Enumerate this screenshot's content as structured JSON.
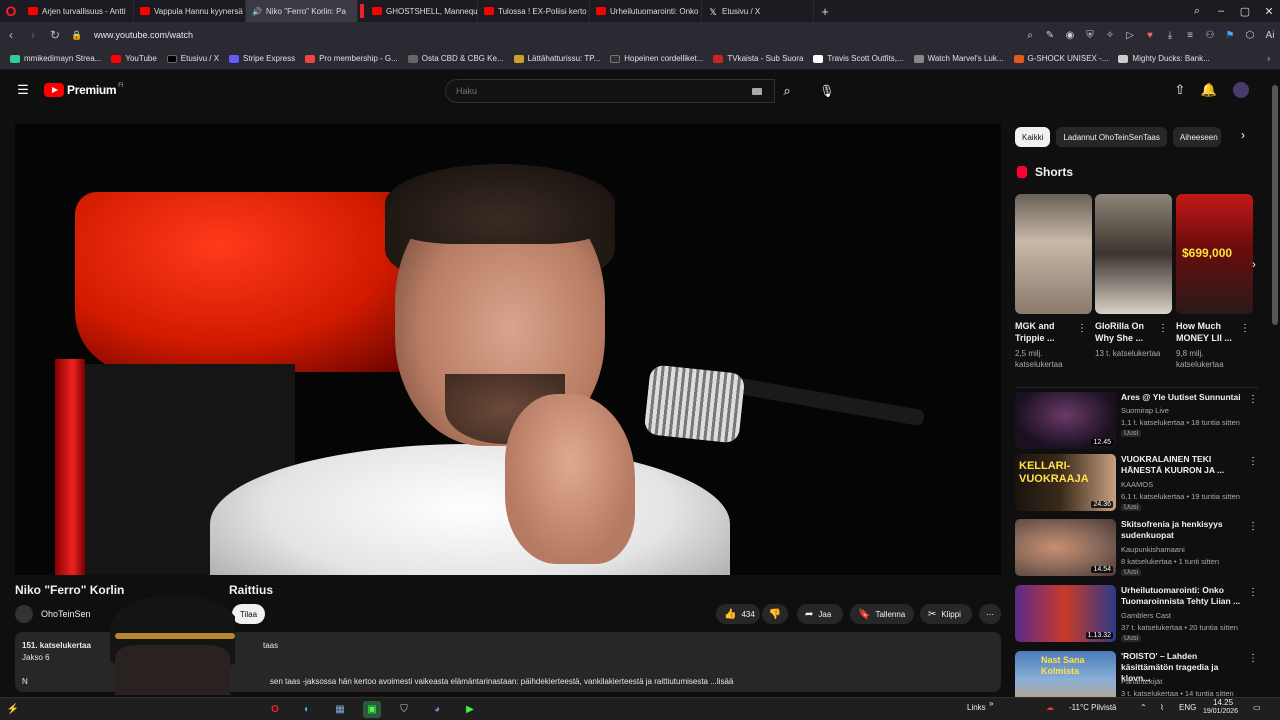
{
  "browser": {
    "tabs": [
      {
        "label": "Arjen turvallisuus - Antti",
        "icon": "youtube-icon"
      },
      {
        "label": "Vappula Hannu kyynersä",
        "icon": "youtube-icon"
      },
      {
        "label": "Niko \"Ferro\" Korlin: Pa",
        "icon": "audio-icon",
        "active": true
      },
      {
        "label": "GHOSTSHELL, Mannequi",
        "icon": "youtube-icon"
      },
      {
        "label": "Tulossa ! EX-Poliisi kerto",
        "icon": "youtube-icon"
      },
      {
        "label": "Urheilutuomarointi: Onko",
        "icon": "youtube-icon"
      },
      {
        "label": "Etusivu / X",
        "icon": "x-icon"
      }
    ],
    "url": "www.youtube.com/watch",
    "bookmarks": [
      {
        "label": "mmikedimayn Strea...",
        "color": "#3c9"
      },
      {
        "label": "YouTube",
        "color": "#ff0000"
      },
      {
        "label": "Etusivu / X",
        "color": "#000000"
      },
      {
        "label": "Stripe Express",
        "color": "#635bff"
      },
      {
        "label": "Pro membership - G...",
        "color": "#e44"
      },
      {
        "label": "Osta CBD & CBG Ke...",
        "color": "#666"
      },
      {
        "label": "Lättähatturissu: TP...",
        "color": "#c9a227"
      },
      {
        "label": "Hopeinen cordelliket...",
        "color": "#333"
      },
      {
        "label": "TVkaista - Sub Suora",
        "color": "#c22"
      },
      {
        "label": "Travis Scott Outfits,...",
        "color": "#fff"
      },
      {
        "label": "Watch Marvel's Luk...",
        "color": "#888"
      },
      {
        "label": "G-SHOCK UNISEX -...",
        "color": "#e55a1a"
      },
      {
        "label": "Mighty Ducks: Bank...",
        "color": "#ccc"
      }
    ]
  },
  "youtube": {
    "logo_text": "Premium",
    "logo_sup": "FI",
    "search_placeholder": "Haku",
    "video": {
      "title_left": "Niko \"Ferro\" Korlin",
      "title_right": "Raittius",
      "channel": "OhoTeinSen",
      "subscribe_label": "Tilaa",
      "likes": "434",
      "share_label": "Jaa",
      "save_label": "Tallenna",
      "clip_label": "Klippi",
      "desc_views": "151. katselukertaa",
      "desc_line2": "Jakso 6",
      "desc_taas": "taas",
      "desc_text": "sen taas -jaksossa hän kertoo avoimesti vaikeasta elämäntarinastaan: päihdekierteestä, vankilakierteestä ja raittiutumisesta  ...lisää",
      "desc_n": "N"
    },
    "chips": [
      {
        "label": "Kaikki",
        "active": true
      },
      {
        "label": "Ladannut OhoTeinSenTaas",
        "active": false
      },
      {
        "label": "Aiheeseen",
        "active": false
      }
    ],
    "shorts_header": "Shorts",
    "shorts": [
      {
        "title": "MGK and Trippie ...",
        "views": "2,5 milj. katselukertaa"
      },
      {
        "title": "GloRilla On Why She ...",
        "views": "13 t. katselukertaa"
      },
      {
        "title": "How Much MONEY LIl ...",
        "views": "9,8 milj. katselukertaa",
        "overlay": "$699,000"
      }
    ],
    "recommended": [
      {
        "title": "Ares @ Yle Uutiset Sunnuntai",
        "channel": "Suomirap Live",
        "meta": "1,1 t. katselukertaa • 18 tuntia sitten",
        "badge": "Uusi",
        "duration": "12.45"
      },
      {
        "title": "VUOKRALAINEN TEKI HÄNESTÄ KUURON JA ...",
        "channel": "KAAMOS",
        "meta": "6,1 t. katselukertaa • 19 tuntia sitten",
        "badge": "Uusi",
        "duration": "24.36",
        "thumb_text": "KELLARI-VUOKRAAJA"
      },
      {
        "title": "Skitsofrenia ja henkisyys sudenkuopat",
        "channel": "Kaupunkishamaani",
        "meta": "8 katselukertaa • 1 tunti sitten",
        "badge": "Uusi",
        "duration": "14.54"
      },
      {
        "title": "Urheilutuomarointi: Onko Tuomaroinnista Tehty Liian ...",
        "channel": "Gamblers Cast",
        "meta": "37 t. katselukertaa • 20 tuntia sitten",
        "badge": "Uusi",
        "duration": "1.13.32"
      },
      {
        "title": "'ROISTO' – Lahden käsittämätön tragedia ja klovn...",
        "channel": "Pahantekijät",
        "meta": "3 t. katselukertaa • 14 tuntia sitten",
        "badge": "",
        "duration": "",
        "thumb_text": "Nast Sana Kolmista"
      }
    ]
  },
  "taskbar": {
    "links_label": "Links",
    "weather": "-11°C  Pilvistä",
    "lang": "ENG",
    "time": "14.25",
    "date": "19/01/2026"
  }
}
